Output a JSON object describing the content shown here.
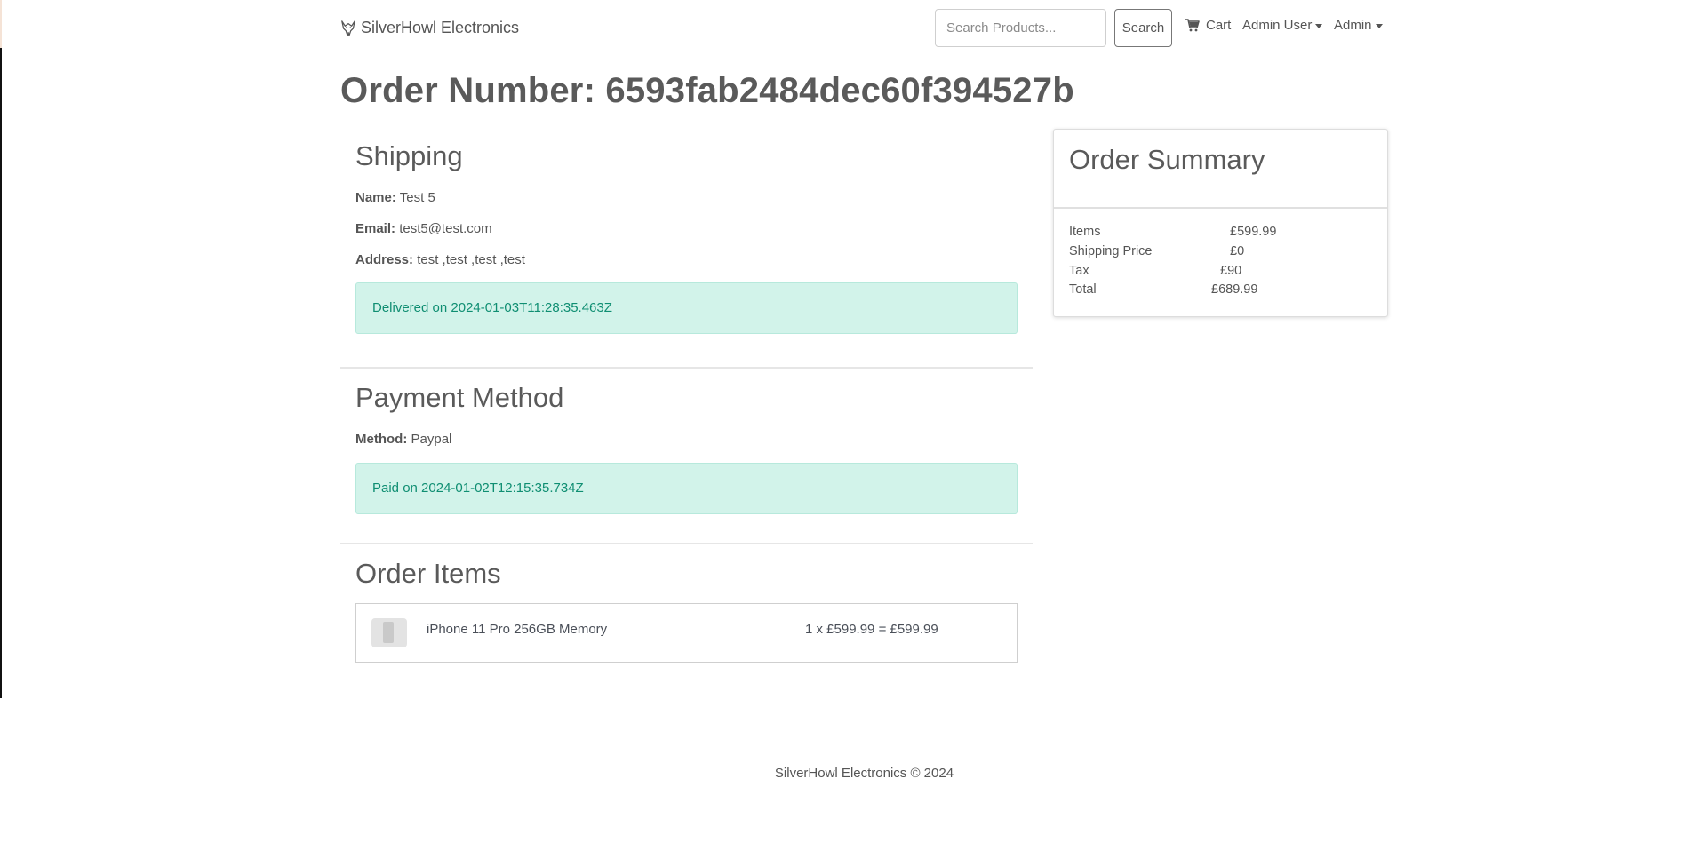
{
  "navbar": {
    "brand": "SilverHowl Electronics",
    "search_placeholder": "Search Products...",
    "search_button": "Search",
    "cart": "Cart",
    "user_menu": "Admin User",
    "admin_menu": "Admin"
  },
  "page_title": "Order Number: 6593fab2484dec60f394527b",
  "shipping": {
    "heading": "Shipping",
    "name_label": "Name:",
    "name_value": "Test 5",
    "email_label": "Email:",
    "email_value": "test5@test.com",
    "address_label": "Address:",
    "address_value": "test ,test ,test ,test",
    "status": "Delivered on 2024-01-03T11:28:35.463Z"
  },
  "payment": {
    "heading": "Payment Method",
    "method_label": "Method:",
    "method_value": "Paypal",
    "status": "Paid on 2024-01-02T12:15:35.734Z"
  },
  "order_items": {
    "heading": "Order Items",
    "items": [
      {
        "name": "iPhone 11 Pro 256GB Memory",
        "price_line": "1 x £599.99 = £599.99"
      }
    ]
  },
  "summary": {
    "heading": "Order Summary",
    "rows": [
      {
        "label": "Items",
        "value": "£599.99"
      },
      {
        "label": "Shipping Price",
        "value": "£0"
      },
      {
        "label": "Tax",
        "value": "£90"
      },
      {
        "label": "Total",
        "value": "£689.99"
      }
    ]
  },
  "footer": "SilverHowl Electronics © 2024",
  "colors": {
    "alert_bg": "#d2f3ea",
    "alert_text": "#0f8e72",
    "text": "#5a5a5a"
  }
}
